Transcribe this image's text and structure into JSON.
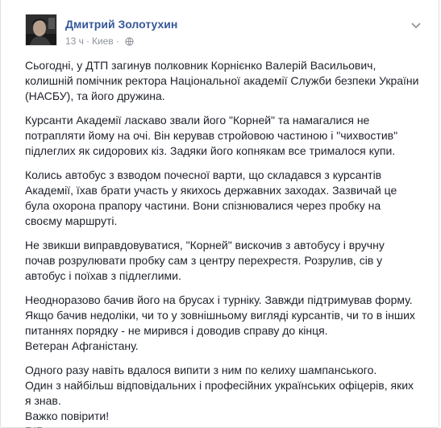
{
  "post": {
    "author": "Дмитрий Золотухин",
    "time": "13 ч",
    "separator": "·",
    "location": "Киев",
    "privacy_icon": "globe-icon",
    "menu_icon": "chevron-down-icon",
    "paragraphs": [
      "Сьогодні, у ДТП загинув полковник Корнієнко Валерій Васильович,\nколишній помічник ректора Національної академії Служби безпеки України\n(НАСБУ), та його дружина.",
      "Курсанти Академії ласкаво звали його \"Корней\" та намагалися не\nпотрапляти йому на очі. Він керував стройовою частиною і \"чихвостив\"\nпідлеглих як сидорових кіз. Задяки його копнякам все трималося купи.",
      "Колись автобус з взводом почесної варти, що складався з курсантів\nАкадемії, їхав брати участь у якихось державних заходах. Зазвичай це\nбула охорона прапору частини. Вони спізнювалися через пробку на\nсвоєму маршруті.",
      "Не звикши виправдовуватися, \"Корней\" вискочив з автобусу і вручну\nпочав розрулювати пробку сам з центру перехрестя. Розрулив, сів у\nавтобус і поїхав з підлеглими.",
      "Неодноразово бачив його на брусах і турніку. Завжди підтримував форму.\nЯкщо бачив недоліки, чи то у зовнішньому вигляді курсантів, чи то в інших\nпитаннях порядку - не мирився і доводив справу до кінця.\nВетеран Афганістану.",
      "Одного разу навіть вдалося випити з ним по келиху шампанського.\nОдин з найбільш відповідальних і професійних українських офіцерів, яких\nя знав.\nВажко повірити!\nRIP"
    ]
  },
  "colors": {
    "author_link": "#365899",
    "meta_text": "#90949c",
    "body_text": "#1d2129",
    "border": "#dddfe2"
  }
}
